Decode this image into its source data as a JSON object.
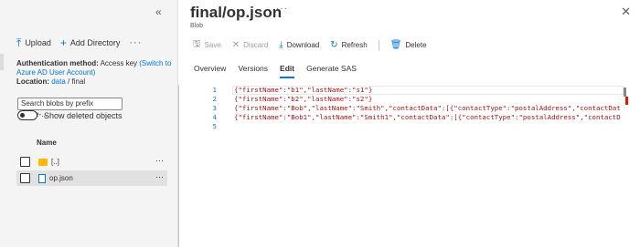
{
  "left": {
    "collapse_glyph": "«",
    "toolbar": {
      "upload": "Upload",
      "add_directory": "Add Directory",
      "more": "···"
    },
    "auth": {
      "method_label": "Authentication method:",
      "method_value": "Access key",
      "switch_link": "(Switch to Azure AD User Account)",
      "location_label": "Location:",
      "location_link": "data",
      "location_sep": "/",
      "location_rest": "final"
    },
    "search": {
      "placeholder": "Search blobs by prefix (case-..."
    },
    "toggle_label": "Show deleted objects",
    "list": {
      "column_name": "Name",
      "rows": [
        {
          "label": "[..]",
          "icon": "folder-icon",
          "more": "···"
        },
        {
          "label": "op.json",
          "icon": "file-json-icon",
          "more": "···"
        }
      ]
    }
  },
  "right": {
    "title": "final/op.json",
    "title_more": "···",
    "subtitle": "Blob",
    "close_glyph": "✕",
    "commands": {
      "save": "Save",
      "discard": "Discard",
      "download": "Download",
      "refresh": "Refresh",
      "delete": "Delete"
    },
    "tabs": [
      "Overview",
      "Versions",
      "Edit",
      "Generate SAS"
    ],
    "active_tab": "Edit"
  },
  "editor": {
    "lines": [
      {
        "n": "1",
        "text": "{\"firstName\":\"b1\",\"lastName\":\"s1\"}"
      },
      {
        "n": "2",
        "text": "{\"firstName\":\"b2\",\"lastName\":\"s2\"}"
      },
      {
        "n": "3",
        "text": "{\"firstName\":\"Bob\",\"lastName\":\"Smith\",\"contactData\":[{\"contactType\":\"postalAddress\",\"contactDat"
      },
      {
        "n": "4",
        "text": "{\"firstName\":\"Bob1\",\"lastName\":\"Smith1\",\"contactData\":[{\"contactType\":\"postalAddress\",\"contactD"
      },
      {
        "n": "5",
        "text": ""
      }
    ]
  },
  "colors": {
    "accent": "#0078d4",
    "folder": "#ffb900",
    "json_string": "#a31515",
    "line_number": "#237893",
    "error_marker": "#e51400"
  }
}
